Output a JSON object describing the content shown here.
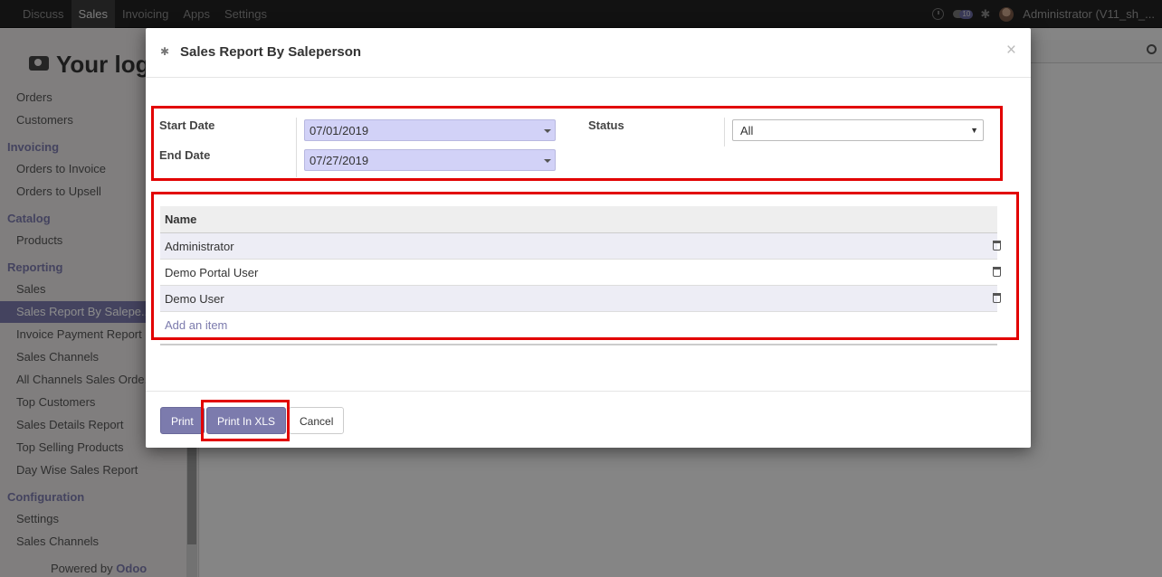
{
  "topbar": {
    "menu": [
      "Discuss",
      "Sales",
      "Invoicing",
      "Apps",
      "Settings"
    ],
    "active_menu": "Sales",
    "chat_count": "10",
    "user": "Administrator (V11_sh_..."
  },
  "sidebar": {
    "logo_text": "Your log",
    "items": [
      {
        "type": "item",
        "label": "Orders"
      },
      {
        "type": "item",
        "label": "Customers"
      },
      {
        "type": "head",
        "label": "Invoicing"
      },
      {
        "type": "item",
        "label": "Orders to Invoice"
      },
      {
        "type": "item",
        "label": "Orders to Upsell"
      },
      {
        "type": "head",
        "label": "Catalog"
      },
      {
        "type": "item",
        "label": "Products"
      },
      {
        "type": "head",
        "label": "Reporting"
      },
      {
        "type": "item",
        "label": "Sales"
      },
      {
        "type": "active",
        "label": "Sales Report By Salepe..."
      },
      {
        "type": "item",
        "label": "Invoice Payment Report"
      },
      {
        "type": "item",
        "label": "Sales Channels"
      },
      {
        "type": "item",
        "label": "All Channels Sales Orde..."
      },
      {
        "type": "item",
        "label": "Top Customers"
      },
      {
        "type": "item",
        "label": "Sales Details Report"
      },
      {
        "type": "item",
        "label": "Top Selling Products"
      },
      {
        "type": "item",
        "label": "Day Wise Sales Report"
      },
      {
        "type": "head",
        "label": "Configuration"
      },
      {
        "type": "item",
        "label": "Settings"
      },
      {
        "type": "item",
        "label": "Sales Channels"
      }
    ],
    "powered_by": "Powered by",
    "powered_brand": "Odoo"
  },
  "modal": {
    "title": "Sales Report By Saleperson",
    "close": "×",
    "start_date_label": "Start Date",
    "start_date_value": "07/01/2019",
    "end_date_label": "End Date",
    "end_date_value": "07/27/2019",
    "status_label": "Status",
    "status_value": "All",
    "table": {
      "header": "Name",
      "rows": [
        "Administrator",
        "Demo Portal User",
        "Demo User"
      ],
      "add_item": "Add an item"
    },
    "buttons": {
      "print": "Print",
      "print_xls": "Print In XLS",
      "cancel": "Cancel"
    }
  }
}
